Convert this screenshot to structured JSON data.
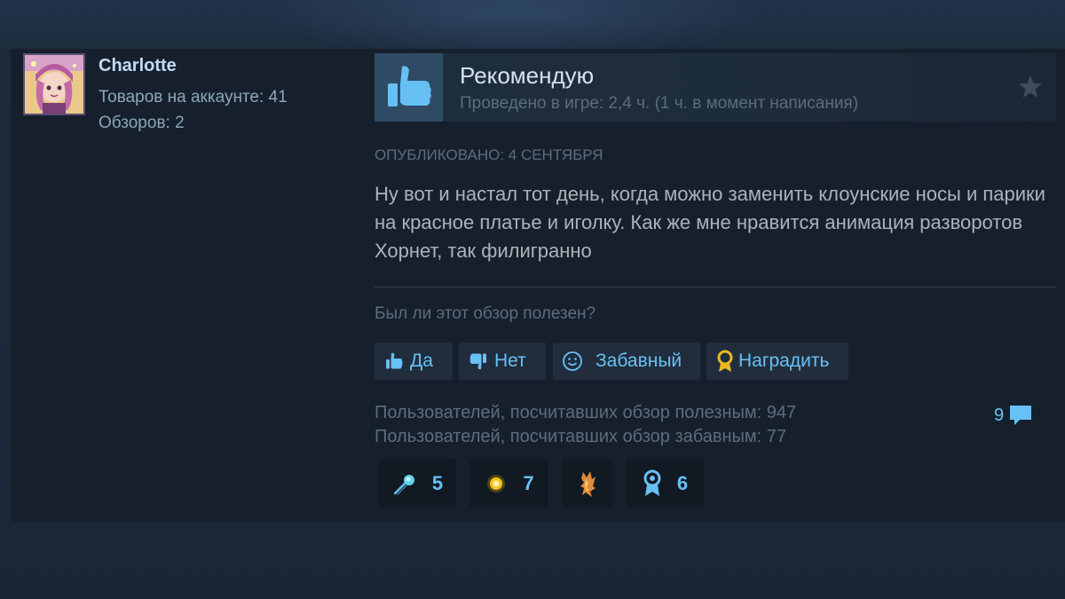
{
  "author": {
    "name": "Charlotte",
    "products_label": "Товаров на аккаунте: 41",
    "reviews_label": "Обзоров: 2"
  },
  "review": {
    "verdict": "Рекомендую",
    "playtime": "Проведено в игре: 2,4 ч. (1 ч. в момент написания)",
    "posted": "Опубликовано: 4 сентября",
    "text": "Ну вот и настал тот день, когда можно заменить клоунские носы и парики на красное платье и иголку. Как же мне нравится анимация разворотов Хорнет, так филигранно",
    "helpful_question": "Был ли этот обзор полезен?"
  },
  "buttons": {
    "yes": "Да",
    "no": "Нет",
    "funny": "Забавный",
    "award": "Наградить"
  },
  "stats": {
    "helpful": "Пользователей, посчитавших обзор полезным: 947",
    "funny": "Пользователей, посчитавших обзор забавным: 77",
    "comments": "9"
  },
  "awards": [
    {
      "icon": "comet-award-icon",
      "count": "5"
    },
    {
      "icon": "sun-award-icon",
      "count": "7"
    },
    {
      "icon": "flame-award-icon",
      "count": ""
    },
    {
      "icon": "ribbon-award-icon",
      "count": "6"
    }
  ],
  "colors": {
    "accent": "#67c1f5",
    "background": "#1b2838",
    "card": "#16202d",
    "award_gold": "#e8b923"
  }
}
